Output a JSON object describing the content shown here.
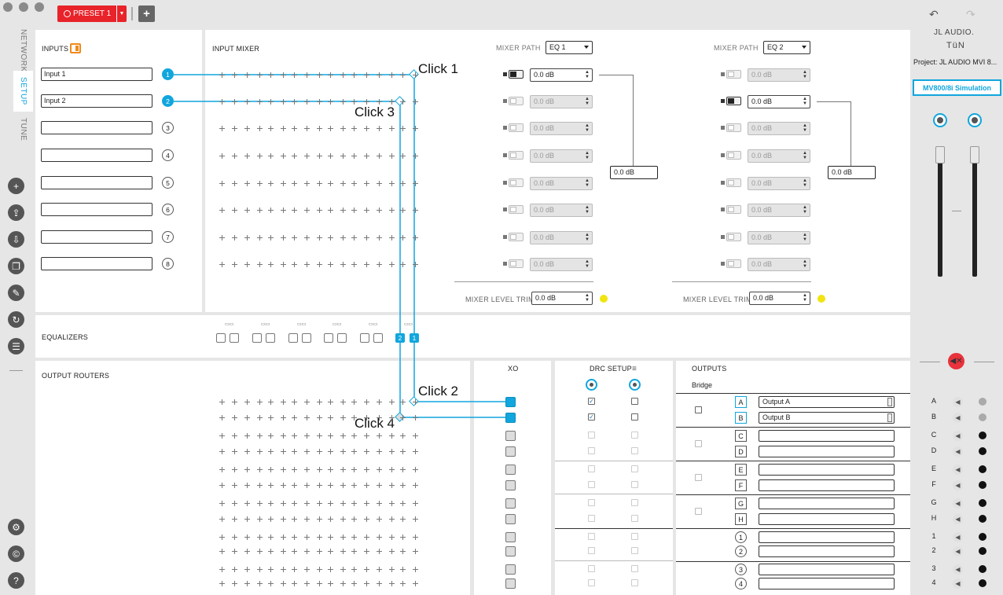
{
  "toolbar": {
    "preset_label": "PRESET 1",
    "preset_color": "#e8232a",
    "add_label": "+"
  },
  "brand": {
    "logo_line1": "JL AUDIO.",
    "logo_line2": "TüN",
    "project": "Project: JL AUDIO MVI 8...",
    "simulation": "MV800/8i Simulation"
  },
  "tabs": [
    "NETWORK",
    "SETUP",
    "TUNE"
  ],
  "inputs": {
    "title": "INPUTS",
    "fields": [
      "Input 1",
      "Input 2",
      "",
      "",
      "",
      "",
      "",
      ""
    ],
    "numbers": [
      "1",
      "2",
      "3",
      "4",
      "5",
      "6",
      "7",
      "8"
    ]
  },
  "input_mixer": {
    "title": "INPUT MIXER",
    "mixers": [
      {
        "path_label": "MIXER PATH",
        "path_value": "EQ 1",
        "levels": [
          "0.0 dB",
          "0.0 dB",
          "0.0 dB",
          "0.0 dB",
          "0.0 dB",
          "0.0 dB",
          "0.0 dB",
          "0.0 dB"
        ],
        "active_index": 0,
        "sum": "0.0 dB",
        "trim_label": "MIXER LEVEL TRIM",
        "trim_value": "0.0 dB"
      },
      {
        "path_label": "MIXER PATH",
        "path_value": "EQ 2",
        "levels": [
          "0.0 dB",
          "0.0 dB",
          "0.0 dB",
          "0.0 dB",
          "0.0 dB",
          "0.0 dB",
          "0.0 dB",
          "0.0 dB"
        ],
        "active_index": 1,
        "sum": "0.0 dB",
        "trim_label": "MIXER LEVEL TRIM",
        "trim_value": "0.0 dB"
      }
    ]
  },
  "equalizers": {
    "title": "EQUALIZERS",
    "active": [
      "2",
      "1"
    ]
  },
  "output_routers": {
    "title": "OUTPUT ROUTERS"
  },
  "xo": {
    "title": "XO"
  },
  "drc": {
    "title": "DRC SETUP"
  },
  "outputs": {
    "title": "OUTPUTS",
    "bridge_label": "Bridge",
    "rows": [
      {
        "id": "A",
        "name": "Output A"
      },
      {
        "id": "B",
        "name": "Output B"
      },
      {
        "id": "C",
        "name": ""
      },
      {
        "id": "D",
        "name": ""
      },
      {
        "id": "E",
        "name": ""
      },
      {
        "id": "F",
        "name": ""
      },
      {
        "id": "G",
        "name": ""
      },
      {
        "id": "H",
        "name": ""
      },
      {
        "id": "1",
        "name": ""
      },
      {
        "id": "2",
        "name": ""
      },
      {
        "id": "3",
        "name": ""
      },
      {
        "id": "4",
        "name": ""
      }
    ]
  },
  "annotations": [
    "Click 1",
    "Click 2",
    "Click 3",
    "Click 4"
  ],
  "accent_color": "#11a6dd",
  "mute_color": "#e8323c"
}
